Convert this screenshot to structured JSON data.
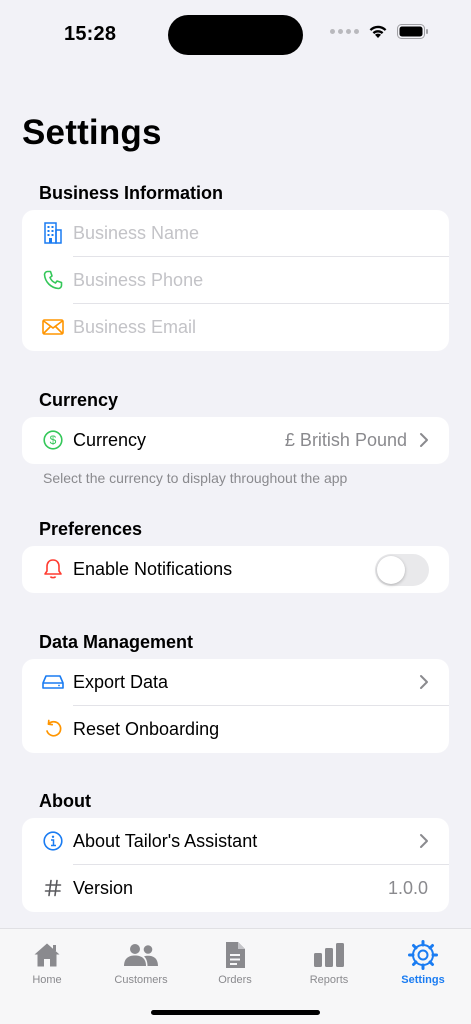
{
  "status": {
    "time": "15:28"
  },
  "title": "Settings",
  "business": {
    "header": "Business Information",
    "name_placeholder": "Business Name",
    "phone_placeholder": "Business Phone",
    "email_placeholder": "Business Email"
  },
  "currency": {
    "header": "Currency",
    "label": "Currency",
    "value": "£ British Pound",
    "footnote": "Select the currency to display throughout the app"
  },
  "preferences": {
    "header": "Preferences",
    "notifications_label": "Enable Notifications",
    "notifications_enabled": false
  },
  "data_management": {
    "header": "Data Management",
    "export_label": "Export Data",
    "reset_label": "Reset Onboarding"
  },
  "about": {
    "header": "About",
    "about_label": "About Tailor's Assistant",
    "version_label": "Version",
    "version_value": "1.0.0"
  },
  "tabs": [
    {
      "label": "Home",
      "icon": "house-icon"
    },
    {
      "label": "Customers",
      "icon": "people-icon"
    },
    {
      "label": "Orders",
      "icon": "document-icon"
    },
    {
      "label": "Reports",
      "icon": "bar-chart-icon"
    },
    {
      "label": "Settings",
      "icon": "gear-icon"
    }
  ],
  "active_tab": "Settings",
  "colors": {
    "accent": "#1a7cf2",
    "background": "#f2f2f7",
    "phone_icon": "#34c759",
    "email_icon": "#ff9500",
    "bell_icon": "#ff3b30",
    "secondary_text": "#8a8a8e"
  }
}
